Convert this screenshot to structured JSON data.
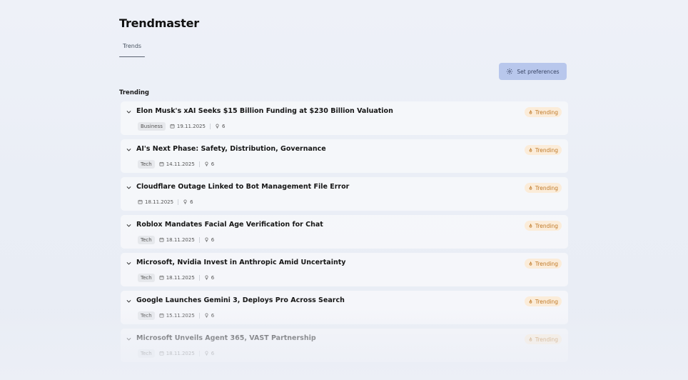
{
  "app": {
    "title": "Trendmaster"
  },
  "tabs": [
    {
      "label": "Trends",
      "active": true
    }
  ],
  "toolbar": {
    "preferences_label": "Set preferences",
    "preferences_icon": "gear-icon"
  },
  "section": {
    "title": "Trending"
  },
  "colors": {
    "accent_button": "#b8c7ec",
    "badge_bg": "#fbecd9",
    "badge_text": "#c07a28"
  },
  "trends": [
    {
      "title": "Elon Musk's xAI Seeks $15 Billion Funding at $230 Billion Valuation",
      "tag": "Business",
      "date": "19.11.2025",
      "count": "6",
      "badge": "Trending"
    },
    {
      "title": "AI's Next Phase: Safety, Distribution, Governance",
      "tag": "Tech",
      "date": "14.11.2025",
      "count": "6",
      "badge": "Trending"
    },
    {
      "title": "Cloudflare Outage Linked to Bot Management File Error",
      "tag": "",
      "date": "18.11.2025",
      "count": "6",
      "badge": "Trending"
    },
    {
      "title": "Roblox Mandates Facial Age Verification for Chat",
      "tag": "Tech",
      "date": "18.11.2025",
      "count": "6",
      "badge": "Trending"
    },
    {
      "title": "Microsoft, Nvidia Invest in Anthropic Amid Uncertainty",
      "tag": "Tech",
      "date": "18.11.2025",
      "count": "6",
      "badge": "Trending"
    },
    {
      "title": "Google Launches Gemini 3, Deploys Pro Across Search",
      "tag": "Tech",
      "date": "15.11.2025",
      "count": "6",
      "badge": "Trending"
    },
    {
      "title": "Microsoft Unveils Agent 365, VAST Partnership",
      "tag": "Tech",
      "date": "18.11.2025",
      "count": "6",
      "badge": "Trending"
    }
  ]
}
